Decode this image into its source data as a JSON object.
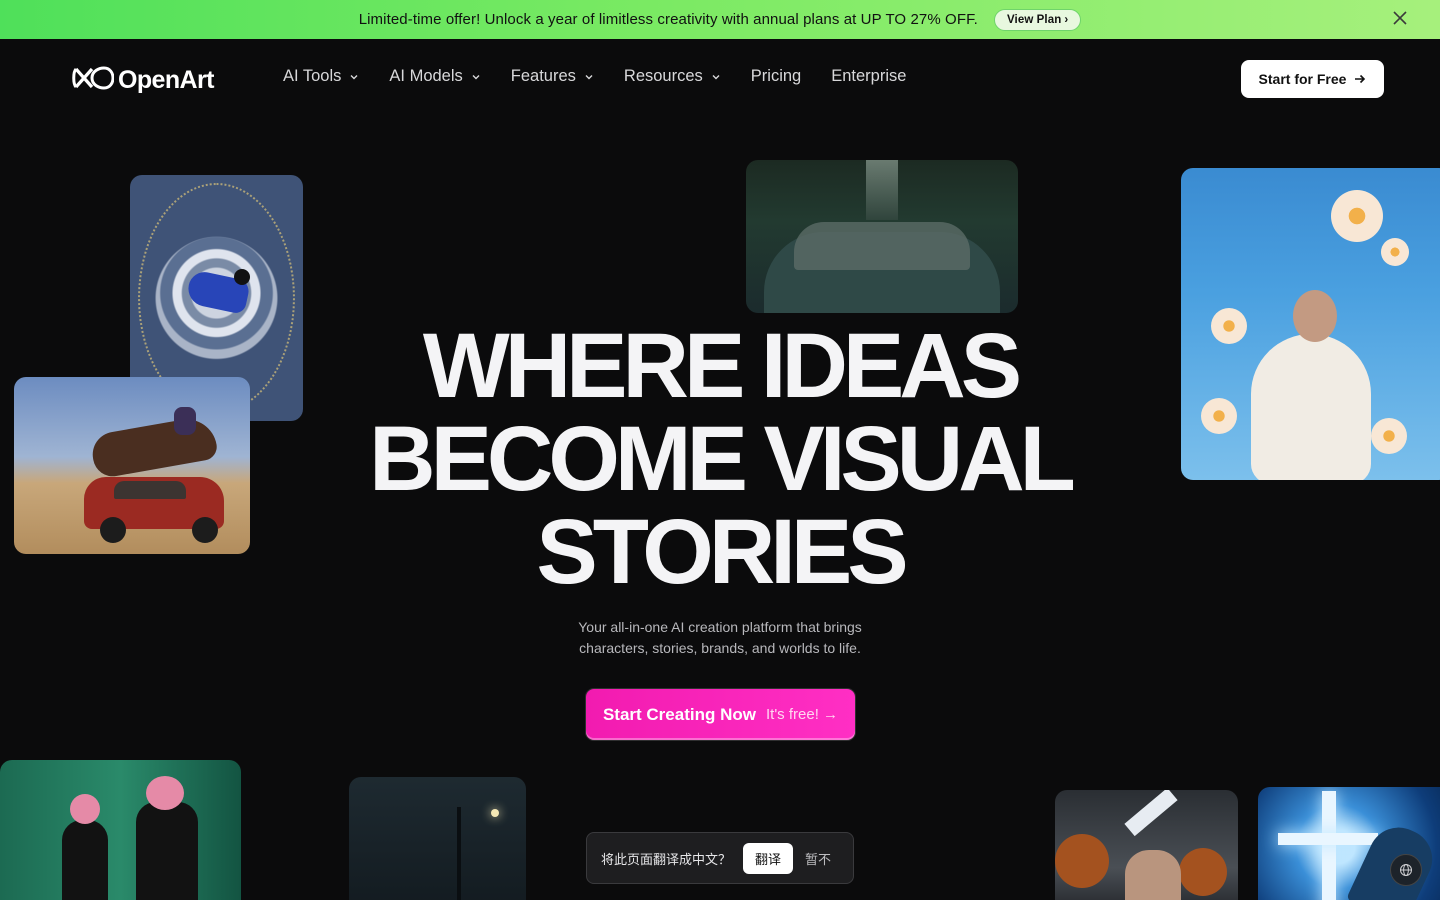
{
  "promo": {
    "text": "Limited-time offer! Unlock a year of limitless creativity with annual plans at UP TO 27% OFF.",
    "button_label": "View Plan",
    "button_arrow": "›",
    "close_icon": "close-icon"
  },
  "nav": {
    "logo_text": "OpenArt",
    "items": [
      {
        "label": "AI Tools",
        "dropdown": true
      },
      {
        "label": "AI Models",
        "dropdown": true
      },
      {
        "label": "Features",
        "dropdown": true
      },
      {
        "label": "Resources",
        "dropdown": true
      },
      {
        "label": "Pricing",
        "dropdown": false
      },
      {
        "label": "Enterprise",
        "dropdown": false
      }
    ],
    "cta_label": "Start for Free"
  },
  "hero": {
    "title_line1": "WHERE IDEAS",
    "title_line2": "BECOME VISUAL",
    "title_line3": "STORIES",
    "subtitle_line1": "Your all-in-one AI creation platform that brings",
    "subtitle_line2": "characters, stories, brands, and worlds to life.",
    "cta_main": "Start Creating Now",
    "cta_aux": "It's free! →"
  },
  "translate_prompt": {
    "question": "将此页面翻译成中文？",
    "accept_label": "翻译",
    "decline_label": "暂不"
  },
  "colors": {
    "promo_gradient_start": "#4fe05a",
    "promo_gradient_end": "#a6f07c",
    "background": "#0b0b0c",
    "cta_pink": "#f21bb0"
  }
}
